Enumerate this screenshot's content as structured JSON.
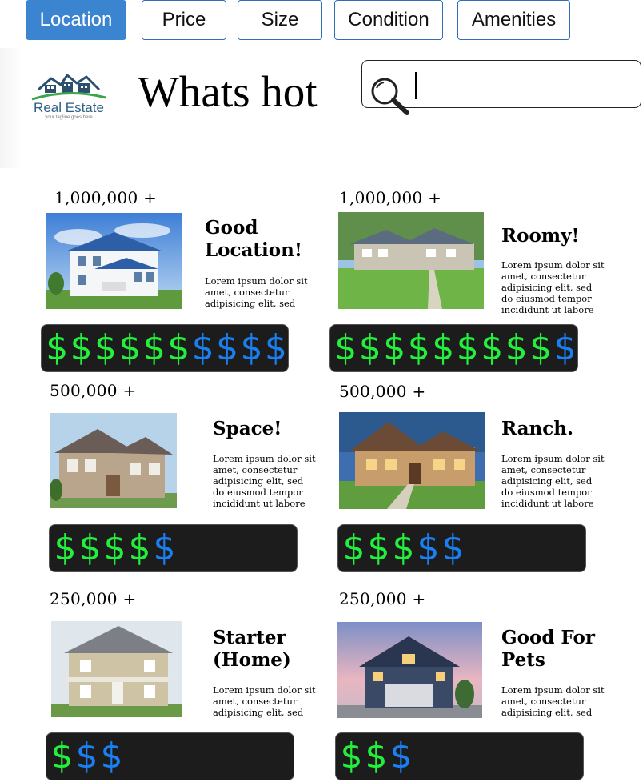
{
  "filters": [
    {
      "label": "Location",
      "active": true
    },
    {
      "label": "Price",
      "active": false
    },
    {
      "label": "Size",
      "active": false
    },
    {
      "label": "Condition",
      "active": false
    },
    {
      "label": "Amenities",
      "active": false
    }
  ],
  "logo": {
    "name": "Real Estate",
    "tagline": "your tagline goes here",
    "icon": "houses-logo-icon"
  },
  "headline": "Whats hot",
  "search": {
    "placeholder": "",
    "value": "",
    "icon": "search-icon"
  },
  "colors": {
    "accent": "#3b84d0",
    "dollar_on": "#22f03c",
    "dollar_off": "#1a7ff0",
    "bar_bg": "#1c1c1c"
  },
  "listings": [
    {
      "price": "1,000,000 +",
      "title": "Good Location!",
      "desc": "Lorem ipsum dolor sit amet, consectetur adipisicing elit, sed do",
      "rating_on": 6,
      "rating_total": 10
    },
    {
      "price": "1,000,000 +",
      "title": "Roomy!",
      "desc": "Lorem ipsum dolor sit amet, consectetur adipisicing elit, sed do eiusmod tempor incididunt ut labore et",
      "rating_on": 9,
      "rating_total": 10
    },
    {
      "price": "500,000 +",
      "title": "Space!",
      "desc": "Lorem ipsum dolor sit amet, consectetur adipisicing elit, sed do eiusmod tempor incididunt ut labore et",
      "rating_on": 4,
      "rating_total": 5
    },
    {
      "price": "500,000 +",
      "title": "Ranch.",
      "desc": "Lorem ipsum dolor sit amet, consectetur adipisicing elit, sed do eiusmod tempor incididunt ut labore et",
      "rating_on": 3,
      "rating_total": 5
    },
    {
      "price": "250,000 +",
      "title": "Starter (Home)",
      "desc": "Lorem ipsum dolor sit amet, consectetur adipisicing elit, sed do",
      "rating_on": 1,
      "rating_total": 3
    },
    {
      "price": "250,000 +",
      "title": "Good For Pets",
      "desc": "Lorem ipsum dolor sit amet, consectetur adipisicing elit, sed do",
      "rating_on": 2,
      "rating_total": 3
    }
  ]
}
